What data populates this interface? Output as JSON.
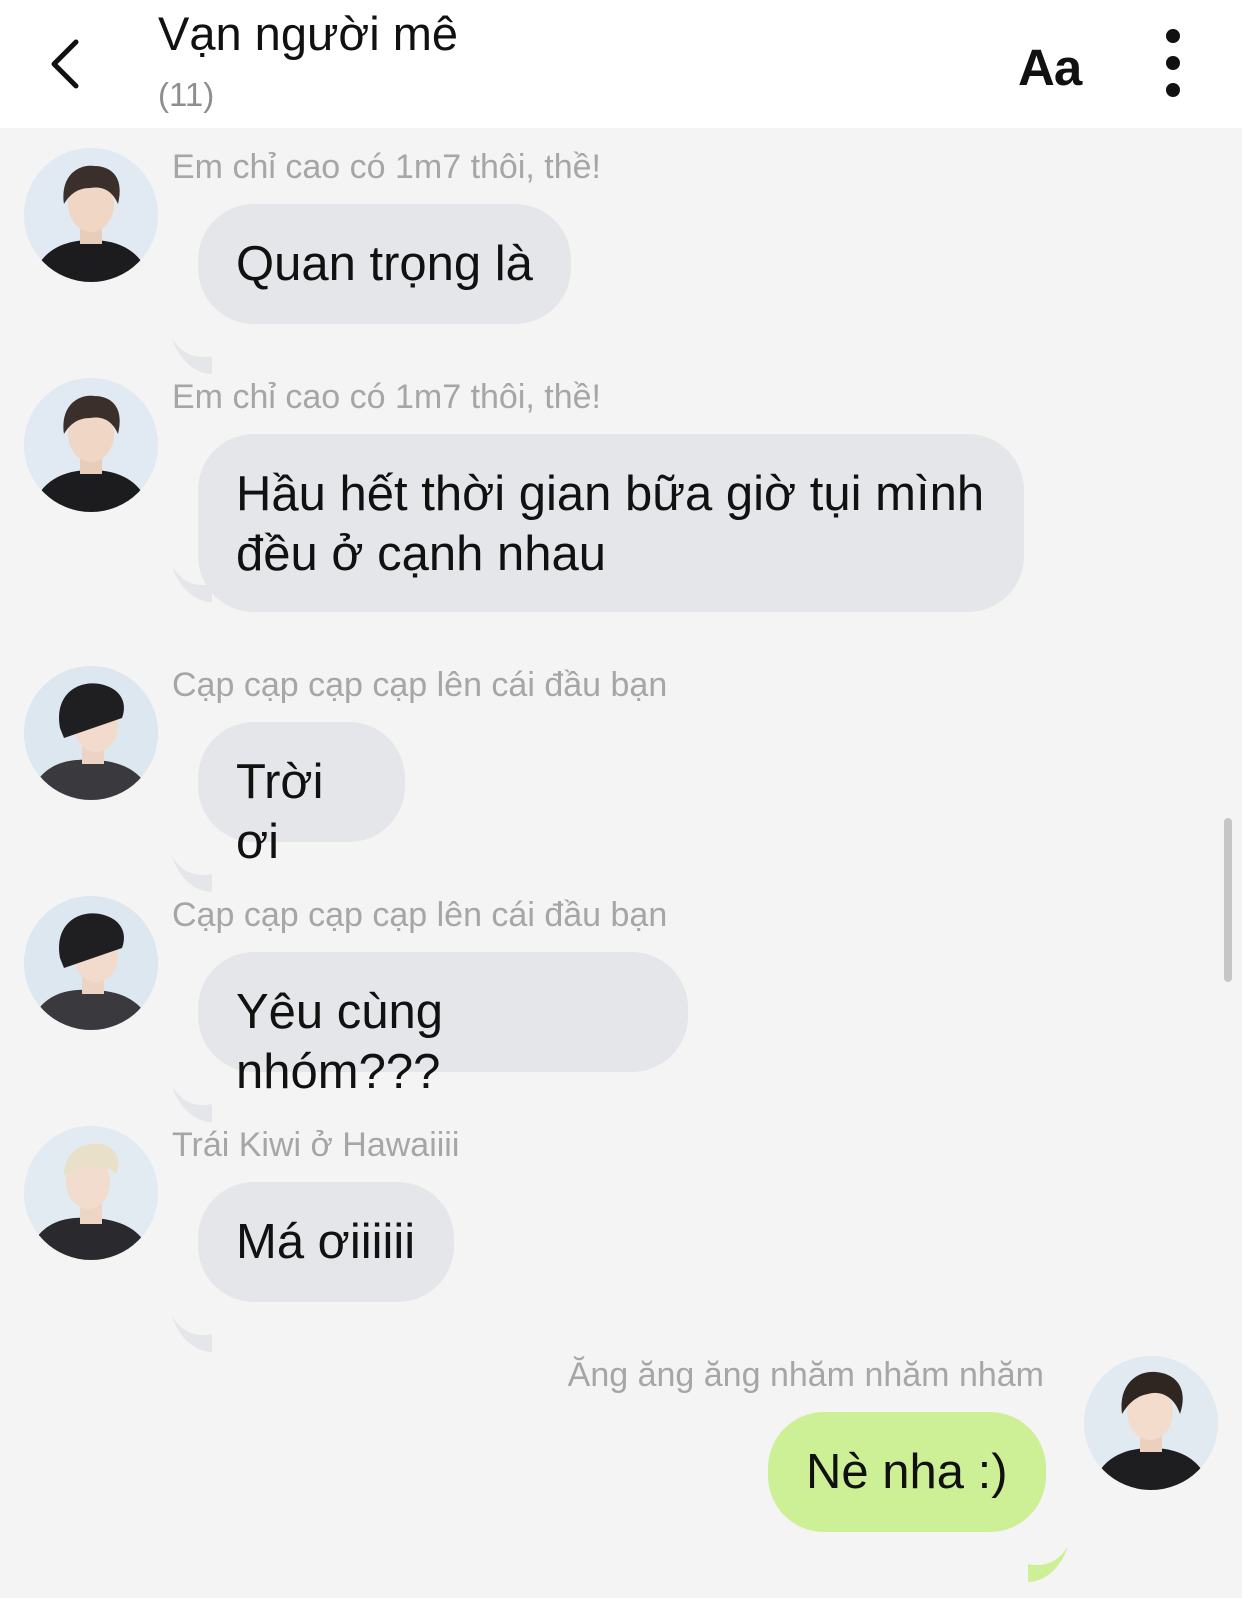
{
  "header": {
    "title": "Vạn người mê",
    "member_count": "(11)",
    "font_button_label": "Aa"
  },
  "messages": [
    {
      "sender": "Em chỉ cao có 1m7 thôi, thề!",
      "text": "Quan trọng là",
      "avatar": "member-avatar-1",
      "outgoing": false
    },
    {
      "sender": "Em chỉ cao có 1m7 thôi, thề!",
      "text": "Hầu hết thời gian bữa giờ tụi mình đều ở cạnh nhau",
      "avatar": "member-avatar-1",
      "outgoing": false
    },
    {
      "sender": "Cạp cạp cạp cạp lên cái đầu bạn",
      "text": "Trời ơi",
      "avatar": "member-avatar-2",
      "outgoing": false
    },
    {
      "sender": "Cạp cạp cạp cạp lên cái đầu bạn",
      "text": "Yêu cùng nhóm???",
      "avatar": "member-avatar-2",
      "outgoing": false
    },
    {
      "sender": "Trái Kiwi ở Hawaiiii",
      "text": "Má ơiiiiii",
      "avatar": "member-avatar-3",
      "outgoing": false
    },
    {
      "sender": "Ăng ăng ăng nhăm nhăm nhăm",
      "text": "Nè nha :)",
      "avatar": "my-avatar",
      "outgoing": true
    }
  ],
  "colors": {
    "incoming_bubble": "#e4e6e9",
    "outgoing_bubble": "#cdf097",
    "background": "#f4f4f4",
    "sender_name": "#a6a6a6"
  },
  "icons": [
    "back-arrow-icon",
    "more-vertical-icon"
  ]
}
